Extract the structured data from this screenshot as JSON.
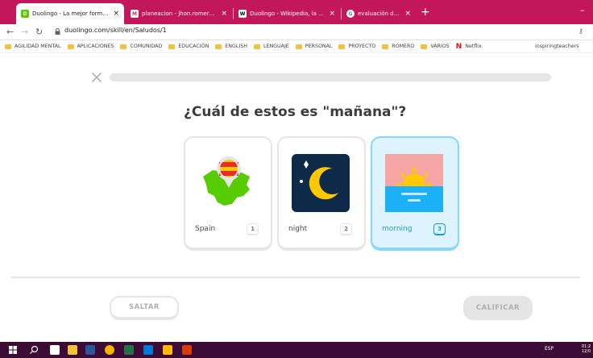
{
  "browser": {
    "tabs": [
      {
        "title": "Duolingo - La mejor forma de ap",
        "favicon": "duolingo-icon",
        "active": true
      },
      {
        "title": "planeacion - jhon.romero@ustal",
        "favicon": "gmail-icon",
        "active": false
      },
      {
        "title": "Duolingo - Wikipedia, la enciclo",
        "favicon": "wikipedia-icon",
        "active": false
      },
      {
        "title": "evaluación de duolingo - Buscar",
        "favicon": "google-icon",
        "active": false
      }
    ],
    "new_tab_label": "+",
    "window_min": "–",
    "url": "duolingo.com/skill/en/Saludos/1"
  },
  "bookmarks": {
    "items": [
      "AGILIDAD MENTAL",
      "APLICACIONES",
      "COMUNIDAD",
      "EDUCACIÓN",
      "ENGLISH",
      "LENGUAJE",
      "PERSONAL",
      "PROYECTO",
      "ROMERO",
      "VARIOS",
      "Netflix"
    ],
    "right": "inspiringteachers"
  },
  "lesson": {
    "progress_fraction": 0.0,
    "question": "¿Cuál de estos es \"mañana\"?",
    "choices": [
      {
        "label": "Spain",
        "number": "1",
        "image": "spain-map-icon",
        "selected": false
      },
      {
        "label": "night",
        "number": "2",
        "image": "night-moon-icon",
        "selected": false
      },
      {
        "label": "morning",
        "number": "3",
        "image": "morning-sunrise-icon",
        "selected": true
      }
    ],
    "skip_label": "SALTAR",
    "check_label": "CALIFICAR"
  },
  "taskbar": {
    "lang": "ESP",
    "time": "01:2",
    "date": "12/0"
  },
  "colors": {
    "tabbar": "#c2185b",
    "taskbar": "#3b0b36",
    "selected_bg": "#ddf4ff",
    "selected_border": "#84d8ff",
    "selected_text": "#1899d6"
  }
}
